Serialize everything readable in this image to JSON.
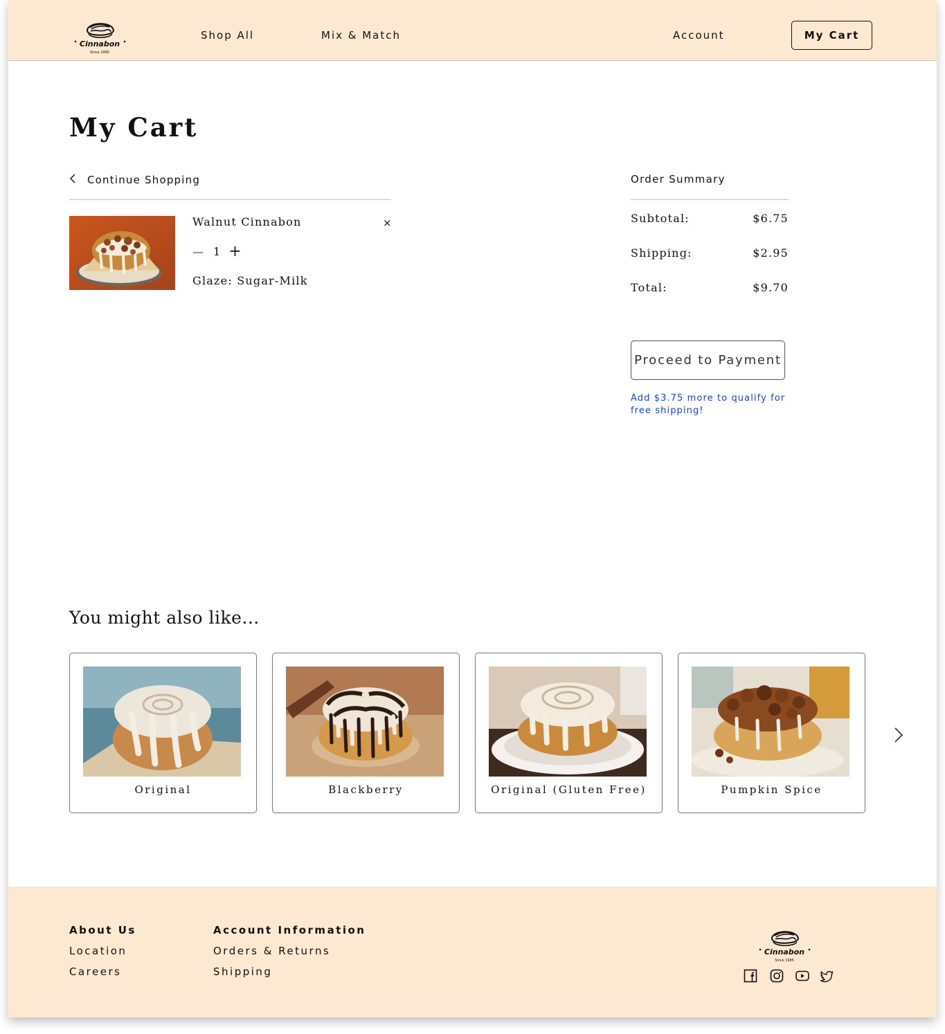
{
  "header": {
    "logo_text": "Cinnabon",
    "logo_subtext": "Since 1985",
    "nav": {
      "shop_all": "Shop All",
      "mix_match": "Mix & Match",
      "account": "Account",
      "cart": "My Cart"
    }
  },
  "cart": {
    "title": "My Cart",
    "continue_label": "Continue Shopping",
    "items": [
      {
        "name": "Walnut Cinnabon",
        "remove": "×",
        "qty_minus": "—",
        "qty": "1",
        "qty_plus": "+",
        "glaze": "Glaze: Sugar-Milk"
      }
    ]
  },
  "summary": {
    "title": "Order Summary",
    "subtotal_label": "Subtotal:",
    "subtotal": "$6.75",
    "shipping_label": "Shipping:",
    "shipping": "$2.95",
    "total_label": "Total:",
    "total": "$9.70",
    "pay_label": "Proceed to Payment",
    "free_shipping_note": "Add $3.75 more to qualify for free shipping!"
  },
  "recommendations": {
    "title": "You might also like...",
    "items": [
      {
        "label": "Original"
      },
      {
        "label": "Blackberry"
      },
      {
        "label": "Original (Gluten Free)"
      },
      {
        "label": "Pumpkin Spice"
      }
    ]
  },
  "footer": {
    "about_heading": "About Us",
    "about_links": [
      "Location",
      "Careers"
    ],
    "account_heading": "Account Information",
    "account_links": [
      "Orders & Returns",
      "Shipping"
    ],
    "social_icons": [
      "facebook-icon",
      "instagram-icon",
      "youtube-icon",
      "twitter-icon"
    ]
  },
  "colors": {
    "header_bg": "#fde8d2",
    "footer_bg": "#fde8d2",
    "link_blue": "#1a3fd6"
  }
}
